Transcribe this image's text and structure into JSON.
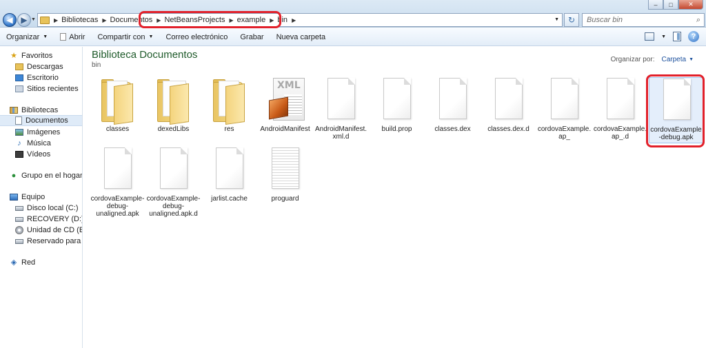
{
  "window": {
    "breadcrumb": [
      "Bibliotecas",
      "Documentos",
      "NetBeansProjects",
      "example",
      "bin"
    ],
    "search_placeholder": "Buscar bin",
    "controls": {
      "minimize": "–",
      "maximize": "□",
      "close": "✕"
    }
  },
  "toolbar": {
    "organize": "Organizar",
    "open": "Abrir",
    "share": "Compartir con",
    "email": "Correo electrónico",
    "burn": "Grabar",
    "new_folder": "Nueva carpeta"
  },
  "sidebar": {
    "favorites": {
      "label": "Favoritos",
      "items": [
        "Descargas",
        "Escritorio",
        "Sitios recientes"
      ]
    },
    "libraries": {
      "label": "Bibliotecas",
      "items": [
        "Documentos",
        "Imágenes",
        "Música",
        "Vídeos"
      ],
      "selected": "Documentos"
    },
    "homegroup": {
      "label": "Grupo en el hogar"
    },
    "computer": {
      "label": "Equipo",
      "items": [
        "Disco local (C:)",
        "RECOVERY (D:)",
        "Unidad de CD (E:)",
        "Reservado para el sis"
      ]
    },
    "network": {
      "label": "Red"
    }
  },
  "content": {
    "title": "Biblioteca Documentos",
    "subtitle": "bin",
    "arrange_by_label": "Organizar por:",
    "arrange_by_value": "Carpeta",
    "files": [
      {
        "name": "classes",
        "type": "folder"
      },
      {
        "name": "dexedLibs",
        "type": "folder"
      },
      {
        "name": "res",
        "type": "folder"
      },
      {
        "name": "AndroidManifest",
        "type": "xml"
      },
      {
        "name": "AndroidManifest.xml.d",
        "type": "file"
      },
      {
        "name": "build.prop",
        "type": "file"
      },
      {
        "name": "classes.dex",
        "type": "file"
      },
      {
        "name": "classes.dex.d",
        "type": "file"
      },
      {
        "name": "cordovaExample.ap_",
        "type": "file"
      },
      {
        "name": "cordovaExample.ap_.d",
        "type": "file"
      },
      {
        "name": "cordovaExample-debug.apk",
        "type": "file",
        "selected": true
      },
      {
        "name": "cordovaExample-debug-unaligned.apk",
        "type": "file"
      },
      {
        "name": "cordovaExample-debug-unaligned.apk.d",
        "type": "file"
      },
      {
        "name": "jarlist.cache",
        "type": "file"
      },
      {
        "name": "proguard",
        "type": "text"
      }
    ]
  },
  "colors": {
    "highlight": "#e2202a",
    "title_green": "#1e5a2a",
    "link_blue": "#1a4f9c"
  }
}
